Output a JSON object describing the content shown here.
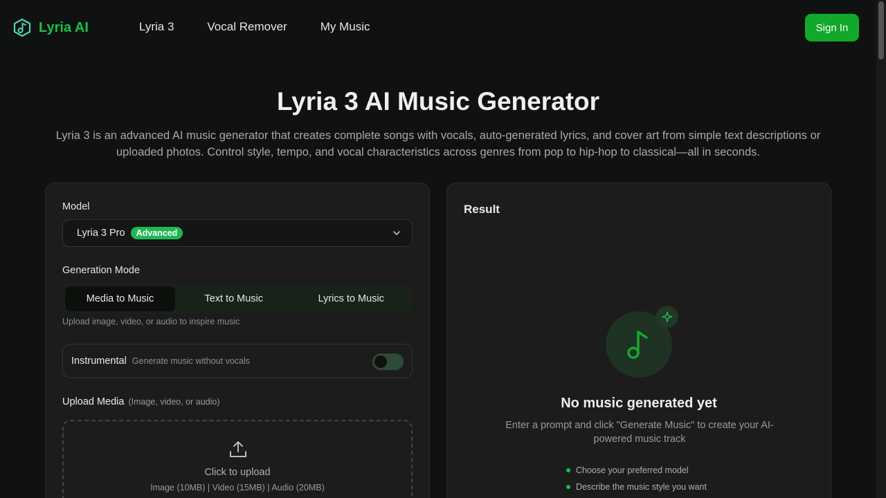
{
  "brand": {
    "name": "Lyria AI",
    "accent": "#19c048"
  },
  "nav": {
    "items": [
      "Lyria 3",
      "Vocal Remover",
      "My Music"
    ],
    "signin": "Sign In"
  },
  "hero": {
    "title": "Lyria 3 AI Music Generator",
    "description": "Lyria 3 is an advanced AI music generator that creates complete songs with vocals, auto-generated lyrics, and cover art from simple text descriptions or uploaded photos. Control style, tempo, and vocal characteristics across genres from pop to hip-hop to classical—all in seconds."
  },
  "form": {
    "model_label": "Model",
    "model_value": "Lyria 3 Pro",
    "model_badge": "Advanced",
    "mode_label": "Generation Mode",
    "modes": [
      "Media to Music",
      "Text to Music",
      "Lyrics to Music"
    ],
    "active_mode": "Media to Music",
    "mode_hint": "Upload image, video, or audio to inspire music",
    "instrumental_label": "Instrumental",
    "instrumental_sub": "Generate music without vocals",
    "instrumental_on": false,
    "upload_label": "Upload Media",
    "upload_sub": "(Image, video, or audio)",
    "upload_text": "Click to upload",
    "upload_limits": "Image (10MB) | Video (15MB) | Audio (20MB)"
  },
  "result": {
    "title": "Result",
    "empty_title": "No music generated yet",
    "empty_desc": "Enter a prompt and click \"Generate Music\" to create your AI-powered music track",
    "tips": [
      "Choose your preferred model",
      "Describe the music style you want"
    ]
  },
  "icons": {
    "logo": "music-note-hexagon-icon",
    "chevron": "chevron-down-icon",
    "upload": "upload-icon",
    "music": "music-note-icon",
    "sparkle": "sparkle-icon"
  }
}
